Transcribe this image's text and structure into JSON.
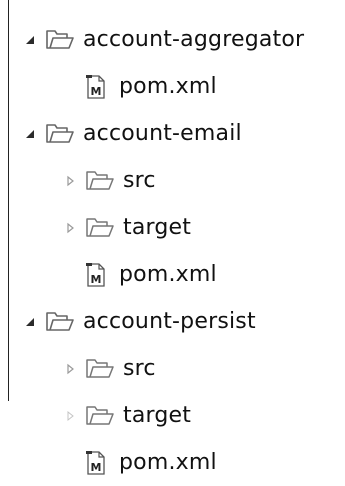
{
  "tree": {
    "items": [
      {
        "label": "account-aggregator",
        "type": "project",
        "state": "expanded",
        "icon": "folder-open-icon"
      },
      {
        "label": "pom.xml",
        "type": "file",
        "icon": "maven-pom-file-icon"
      },
      {
        "label": "account-email",
        "type": "project",
        "state": "expanded",
        "icon": "folder-open-icon"
      },
      {
        "label": "src",
        "type": "folder",
        "state": "collapsed",
        "icon": "folder-open-icon"
      },
      {
        "label": "target",
        "type": "folder",
        "state": "collapsed",
        "icon": "folder-open-icon"
      },
      {
        "label": "pom.xml",
        "type": "file",
        "icon": "maven-pom-file-icon"
      },
      {
        "label": "account-persist",
        "type": "project",
        "state": "expanded",
        "icon": "folder-open-icon"
      },
      {
        "label": "src",
        "type": "folder",
        "state": "collapsed",
        "icon": "folder-open-icon"
      },
      {
        "label": "target",
        "type": "folder",
        "state": "collapsed",
        "icon": "folder-open-icon"
      },
      {
        "label": "pom.xml",
        "type": "file",
        "icon": "maven-pom-file-icon"
      }
    ]
  },
  "colors": {
    "text": "#111111",
    "icon_stroke": "#666666",
    "expander_filled": "#2b2b2b",
    "expander_hollow": "#9a9a9a"
  }
}
